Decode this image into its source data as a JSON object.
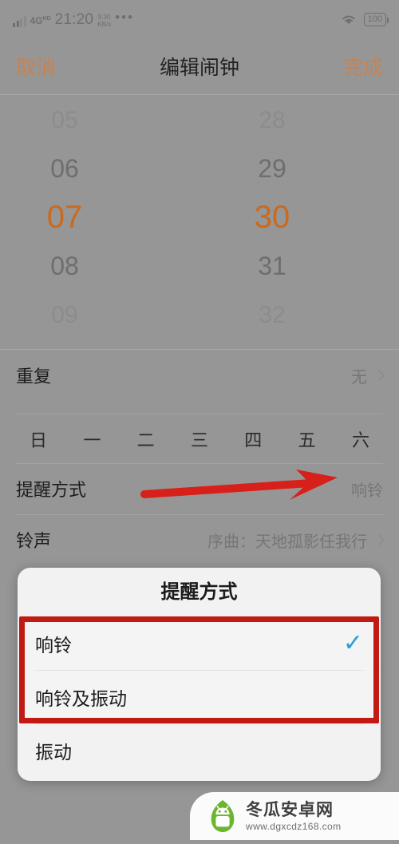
{
  "status_bar": {
    "network_type": "4G",
    "network_sup": "HD",
    "time": "21:20",
    "speed_value": "9.30",
    "speed_unit": "KB/s",
    "overflow": "•••",
    "wifi_icon": "wifi-icon",
    "battery_level": "100"
  },
  "nav": {
    "cancel_label": "取消",
    "title": "编辑闹钟",
    "done_label": "完成",
    "accent_color": "#c98250"
  },
  "time_picker": {
    "hours": [
      "05",
      "06",
      "07",
      "08",
      "09"
    ],
    "minutes": [
      "28",
      "29",
      "30",
      "31",
      "32"
    ],
    "selected_hour": "07",
    "selected_minute": "30",
    "selected_color": "#c96a1e"
  },
  "rows": {
    "repeat": {
      "label": "重复",
      "value": "无",
      "chevron": "chevron-right-icon"
    },
    "weekdays": [
      "日",
      "一",
      "二",
      "三",
      "四",
      "五",
      "六"
    ],
    "reminder_method": {
      "label": "提醒方式",
      "value": "响铃"
    },
    "ringtone": {
      "label": "铃声",
      "value": "序曲：天地孤影任我行",
      "chevron": "chevron-right-icon"
    }
  },
  "annotation": {
    "arrow_color": "#d8201a",
    "highlight_color": "#c01a13"
  },
  "dialog": {
    "title": "提醒方式",
    "options": [
      {
        "label": "响铃",
        "checked": true,
        "check_icon": "✓"
      },
      {
        "label": "响铃及振动",
        "checked": false
      },
      {
        "label": "振动",
        "checked": false
      }
    ],
    "check_color": "#2a9fd6"
  },
  "watermark": {
    "title": "冬瓜安卓网",
    "url": "www.dgxcdz168.com",
    "logo_icon": "android-melon-logo",
    "logo_color": "#6cb52d"
  }
}
